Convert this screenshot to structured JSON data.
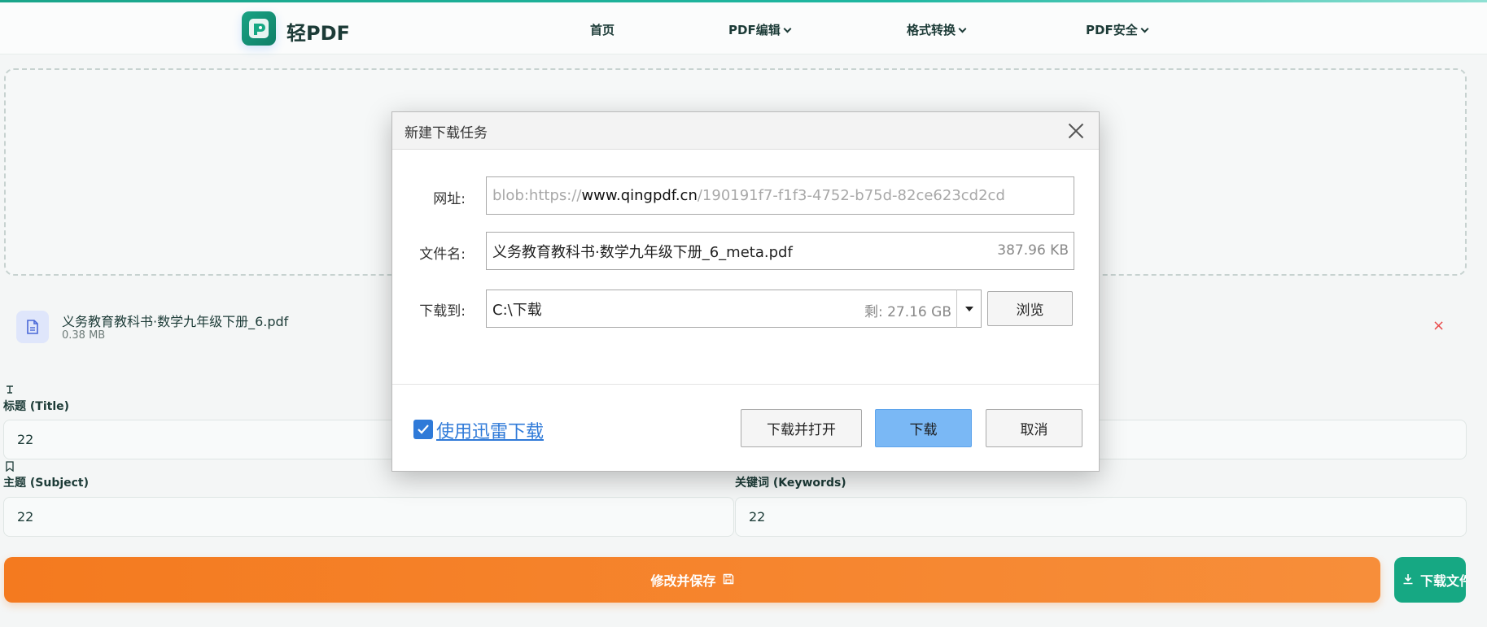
{
  "header": {
    "logo_text": "轻PDF",
    "nav": [
      {
        "label": "首页",
        "has_dropdown": false
      },
      {
        "label": "PDF编辑",
        "has_dropdown": true
      },
      {
        "label": "格式转换",
        "has_dropdown": true
      },
      {
        "label": "PDF安全",
        "has_dropdown": true
      }
    ]
  },
  "file": {
    "name": "义务教育教科书·数学九年级下册_6.pdf",
    "size": "0.38 MB",
    "remove_label": "×"
  },
  "form": {
    "title_label": "标题 (Title)",
    "title_value": "22",
    "subject_label": "主题 (Subject)",
    "subject_value": "22",
    "keywords_label": "关键词 (Keywords)",
    "keywords_value": "22"
  },
  "actions": {
    "save_label": "修改并保存",
    "download_label": "下载文件"
  },
  "dialog": {
    "title": "新建下载任务",
    "url_label": "网址:",
    "url_prefix": "blob:https://",
    "url_host": "www.qingpdf.cn",
    "url_suffix": "/190191f7-f1f3-4752-b75d-82ce623cd2cd",
    "filename_label": "文件名:",
    "filename_value": "义务教育教科书·数学九年级下册_6_meta.pdf",
    "filename_size": "387.96 KB",
    "saveto_label": "下载到:",
    "saveto_value": "C:\\下载",
    "free_space": "剩: 27.16 GB",
    "browse_label": "浏览",
    "xunlei_label": "使用迅雷下载",
    "download_open_label": "下载并打开",
    "download_label": "下载",
    "cancel_label": "取消"
  },
  "colors": {
    "brand": "#16a883",
    "save_orange": "#f47a1f",
    "dialog_primary": "#7ab8f5",
    "link_blue": "#2f7ad8"
  }
}
